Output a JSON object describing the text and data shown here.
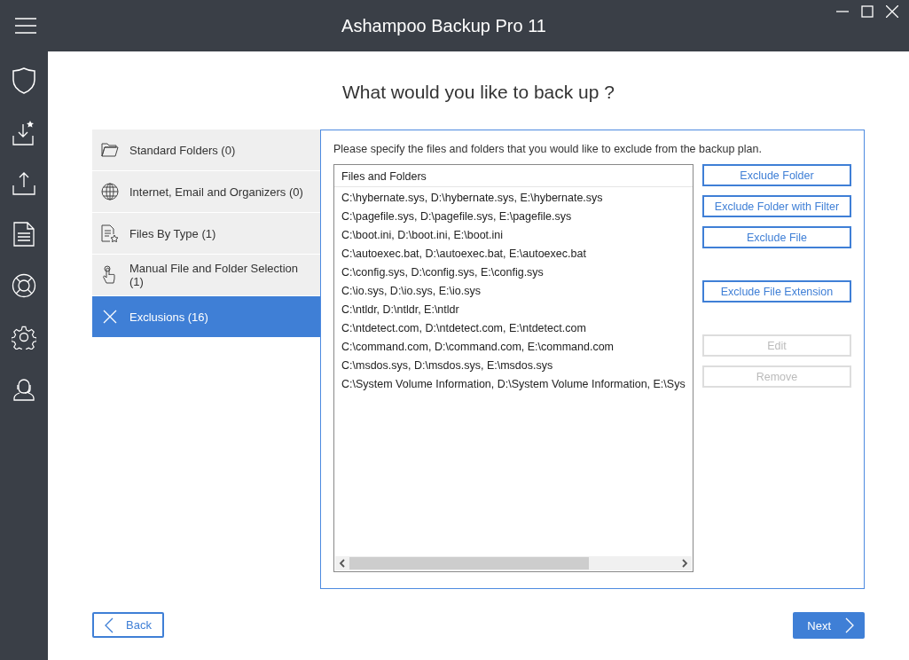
{
  "window": {
    "title": "Ashampoo Backup Pro 11"
  },
  "page_title": "What would you like to back up ?",
  "categories": [
    {
      "label": "Standard Folders (0)",
      "kind": "folder",
      "selected": false
    },
    {
      "label": "Internet, Email and Organizers (0)",
      "kind": "globe",
      "selected": false
    },
    {
      "label": "Files By Type (1)",
      "kind": "filetype",
      "selected": false
    },
    {
      "label": "Manual File and Folder Selection (1)",
      "kind": "hand",
      "selected": false
    },
    {
      "label": "Exclusions (16)",
      "kind": "cross",
      "selected": true
    }
  ],
  "panel": {
    "instruction": "Please specify the files and folders that you would like to exclude from the backup plan.",
    "list": {
      "header": "Files and Folders",
      "rows": [
        "C:\\hybernate.sys, D:\\hybernate.sys, E:\\hybernate.sys",
        "C:\\pagefile.sys, D:\\pagefile.sys, E:\\pagefile.sys",
        "C:\\boot.ini, D:\\boot.ini, E:\\boot.ini",
        "C:\\autoexec.bat, D:\\autoexec.bat, E:\\autoexec.bat",
        "C:\\config.sys, D:\\config.sys, E:\\config.sys",
        "C:\\io.sys, D:\\io.sys, E:\\io.sys",
        "C:\\ntldr, D:\\ntldr, E:\\ntldr",
        "C:\\ntdetect.com, D:\\ntdetect.com, E:\\ntdetect.com",
        "C:\\command.com, D:\\command.com, E:\\command.com",
        "C:\\msdos.sys, D:\\msdos.sys, E:\\msdos.sys",
        "C:\\System Volume Information, D:\\System Volume Information, E:\\Sys"
      ]
    },
    "button_groups": [
      [
        {
          "label": "Exclude Folder",
          "disabled": false
        },
        {
          "label": "Exclude Folder with Filter",
          "disabled": false
        },
        {
          "label": "Exclude File",
          "disabled": false
        }
      ],
      [
        {
          "label": "Exclude File Extension",
          "disabled": false
        }
      ],
      [
        {
          "label": "Edit",
          "disabled": true
        },
        {
          "label": "Remove",
          "disabled": true
        }
      ]
    ]
  },
  "navigation": {
    "back": "Back",
    "next": "Next"
  }
}
